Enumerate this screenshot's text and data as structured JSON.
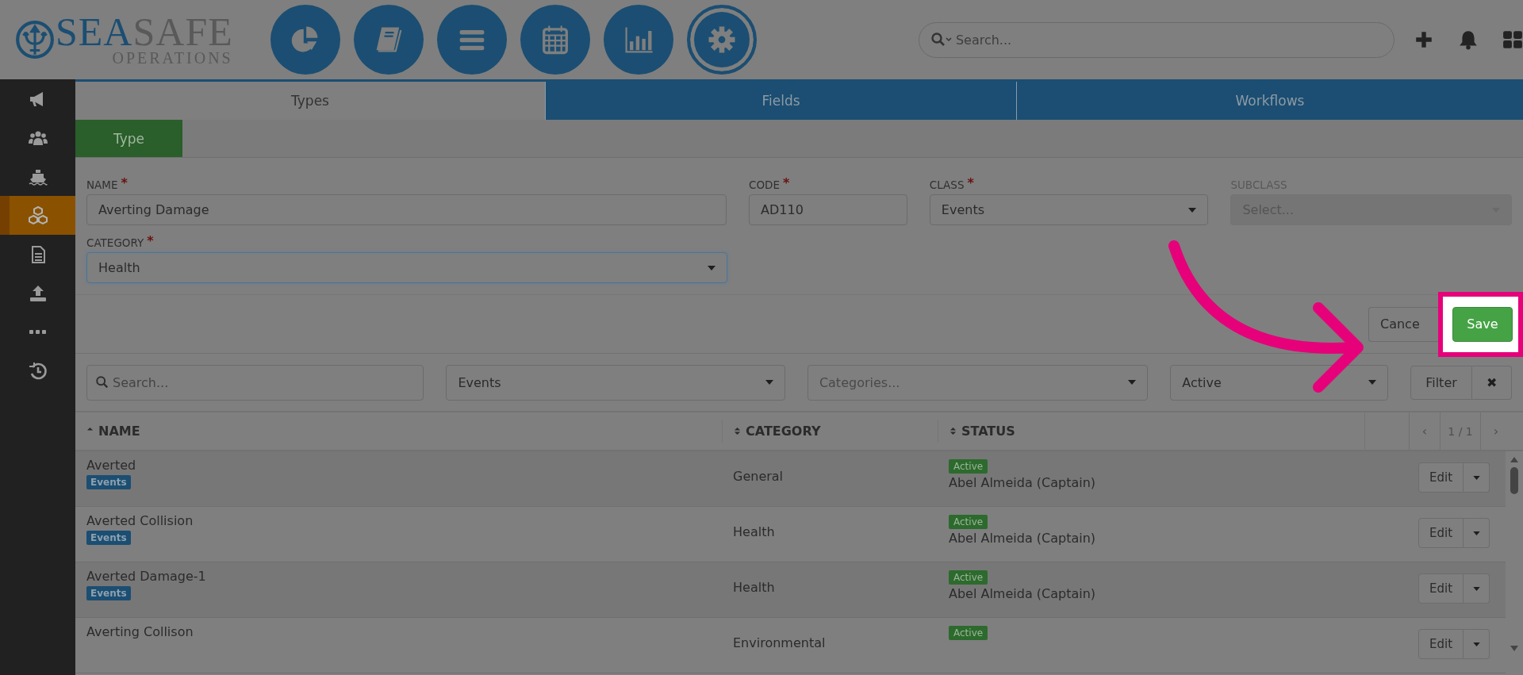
{
  "header": {
    "logo": {
      "part_1": "SEA",
      "part_2": "SAFE",
      "subtitle": "OPERATIONS"
    },
    "nav_buttons": [
      {
        "selected": false
      },
      {
        "selected": false
      },
      {
        "selected": false
      },
      {
        "selected": false
      },
      {
        "selected": false
      },
      {
        "selected": true
      }
    ],
    "search": {
      "placeholder": "Search..."
    }
  },
  "sidebar": {
    "items": [
      {
        "selected": false
      },
      {
        "selected": false
      },
      {
        "selected": false
      },
      {
        "selected": true
      },
      {
        "selected": false
      },
      {
        "selected": false
      },
      {
        "selected": false
      },
      {
        "selected": false
      }
    ]
  },
  "tabs": [
    {
      "label": "Types",
      "selected": true
    },
    {
      "label": "Fields",
      "selected": false
    },
    {
      "label": "Workflows",
      "selected": false
    }
  ],
  "subtabs": [
    {
      "label": "Type",
      "selected": true
    }
  ],
  "form": {
    "rows": [
      [
        {
          "label": "NAME",
          "marker": "*",
          "kind": "text",
          "value": "Averting Damage",
          "disabled": false,
          "focused": false
        },
        {
          "label": "CODE",
          "marker": "*",
          "kind": "text",
          "value": "AD110",
          "disabled": false,
          "focused": false
        },
        {
          "label": "CLASS",
          "marker": "*",
          "kind": "select",
          "value": "Events",
          "disabled": false,
          "focused": false
        },
        {
          "label": "SUBCLASS",
          "kind": "select",
          "placeholder": "Select...",
          "disabled": true,
          "focused": false
        }
      ],
      [
        {
          "label": "CATEGORY",
          "marker": "*",
          "kind": "select",
          "value": "Health",
          "disabled": false,
          "focused": true
        }
      ]
    ]
  },
  "actions": {
    "cancel": "Cance",
    "save": "Save",
    "save_highlighted": true
  },
  "filters": {
    "search": {
      "placeholder": "Search..."
    },
    "selects": [
      {
        "value": "Events"
      },
      {
        "placeholder": "Categories..."
      },
      {
        "value": "Active"
      }
    ],
    "filter_button": "Filter",
    "clear_button": "✖"
  },
  "table": {
    "columns": [
      {
        "label": "NAME",
        "sorted": true
      },
      {
        "label": "CATEGORY",
        "sorted": false
      },
      {
        "label": "STATUS",
        "sorted": false
      }
    ],
    "pager": {
      "prev": "‹",
      "page": "1 / 1",
      "next": "›"
    },
    "rows": [
      {
        "name": "Averted",
        "tag": "Events",
        "category": "General",
        "status": "Active",
        "person": "Abel Almeida (Captain)",
        "action": "Edit"
      },
      {
        "name": "Averted Collision",
        "tag": "Events",
        "category": "Health",
        "status": "Active",
        "person": "Abel Almeida (Captain)",
        "action": "Edit"
      },
      {
        "name": "Averted Damage-1",
        "tag": "Events",
        "category": "Health",
        "status": "Active",
        "person": "Abel Almeida (Captain)",
        "action": "Edit"
      },
      {
        "name": "Averting Collison",
        "category": "Environmental",
        "status": "Active",
        "action": "Edit"
      }
    ]
  }
}
